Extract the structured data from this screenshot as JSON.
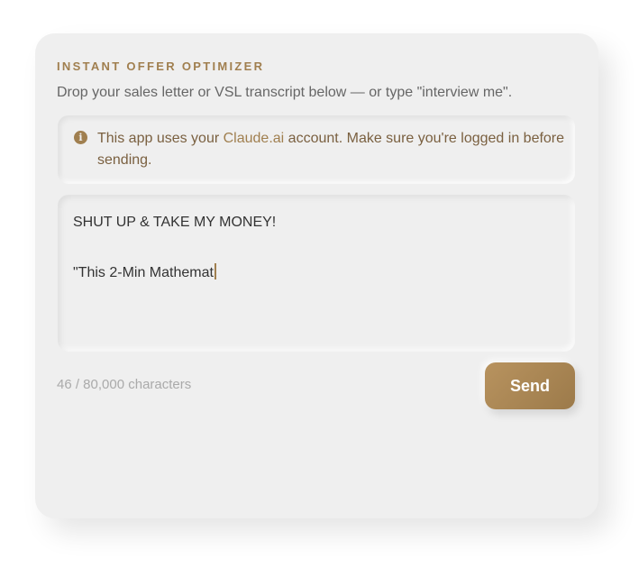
{
  "header": {
    "title": "INSTANT OFFER OPTIMIZER",
    "subtitle": "Drop your sales letter or VSL transcript below — or type \"interview me\"."
  },
  "notice": {
    "icon": "info-icon",
    "icon_glyph": "i",
    "text_before": "This app uses your ",
    "link_text": "Claude.ai",
    "text_after": " account. Make sure you're logged in before sending."
  },
  "editor": {
    "value": "SHUT UP & TAKE MY MONEY!\n\n\"This 2-Min Mathemat"
  },
  "footer": {
    "char_count": "46 / 80,000 characters",
    "send_label": "Send"
  },
  "colors": {
    "accent": "#a07f4f",
    "background": "#efefef"
  }
}
